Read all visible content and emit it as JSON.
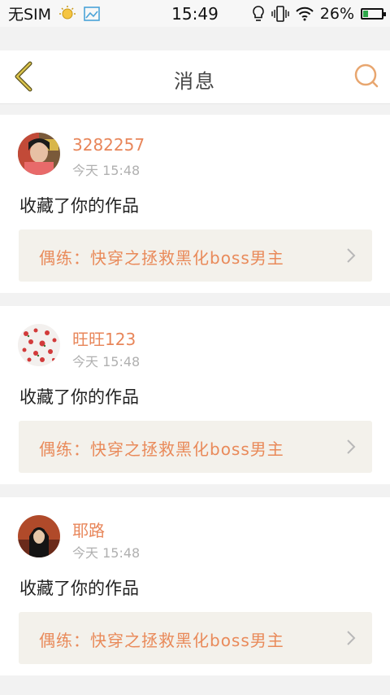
{
  "status_bar": {
    "carrier": "无SIM",
    "time": "15:49",
    "battery_text": "26%",
    "battery_level": 0.26,
    "icons": [
      "bulb-icon",
      "image-icon",
      "lamp-icon",
      "vibrate-icon",
      "wifi-icon",
      "battery-icon"
    ]
  },
  "header": {
    "title": "消息",
    "back_icon": "back-chevron-icon",
    "search_icon": "search-icon"
  },
  "colors": {
    "accent": "#e8865a",
    "work_bg": "#f3f1eb",
    "page_bg": "#f2f2f2"
  },
  "messages": [
    {
      "username": "3282257",
      "time": "今天 15:48",
      "action": "收藏了你的作品",
      "work_title": "偶练：快穿之拯救黑化boss男主"
    },
    {
      "username": "旺旺123",
      "time": "今天 15:48",
      "action": "收藏了你的作品",
      "work_title": "偶练：快穿之拯救黑化boss男主"
    },
    {
      "username": "耶路",
      "time": "今天 15:48",
      "action": "收藏了你的作品",
      "work_title": "偶练：快穿之拯救黑化boss男主"
    }
  ]
}
